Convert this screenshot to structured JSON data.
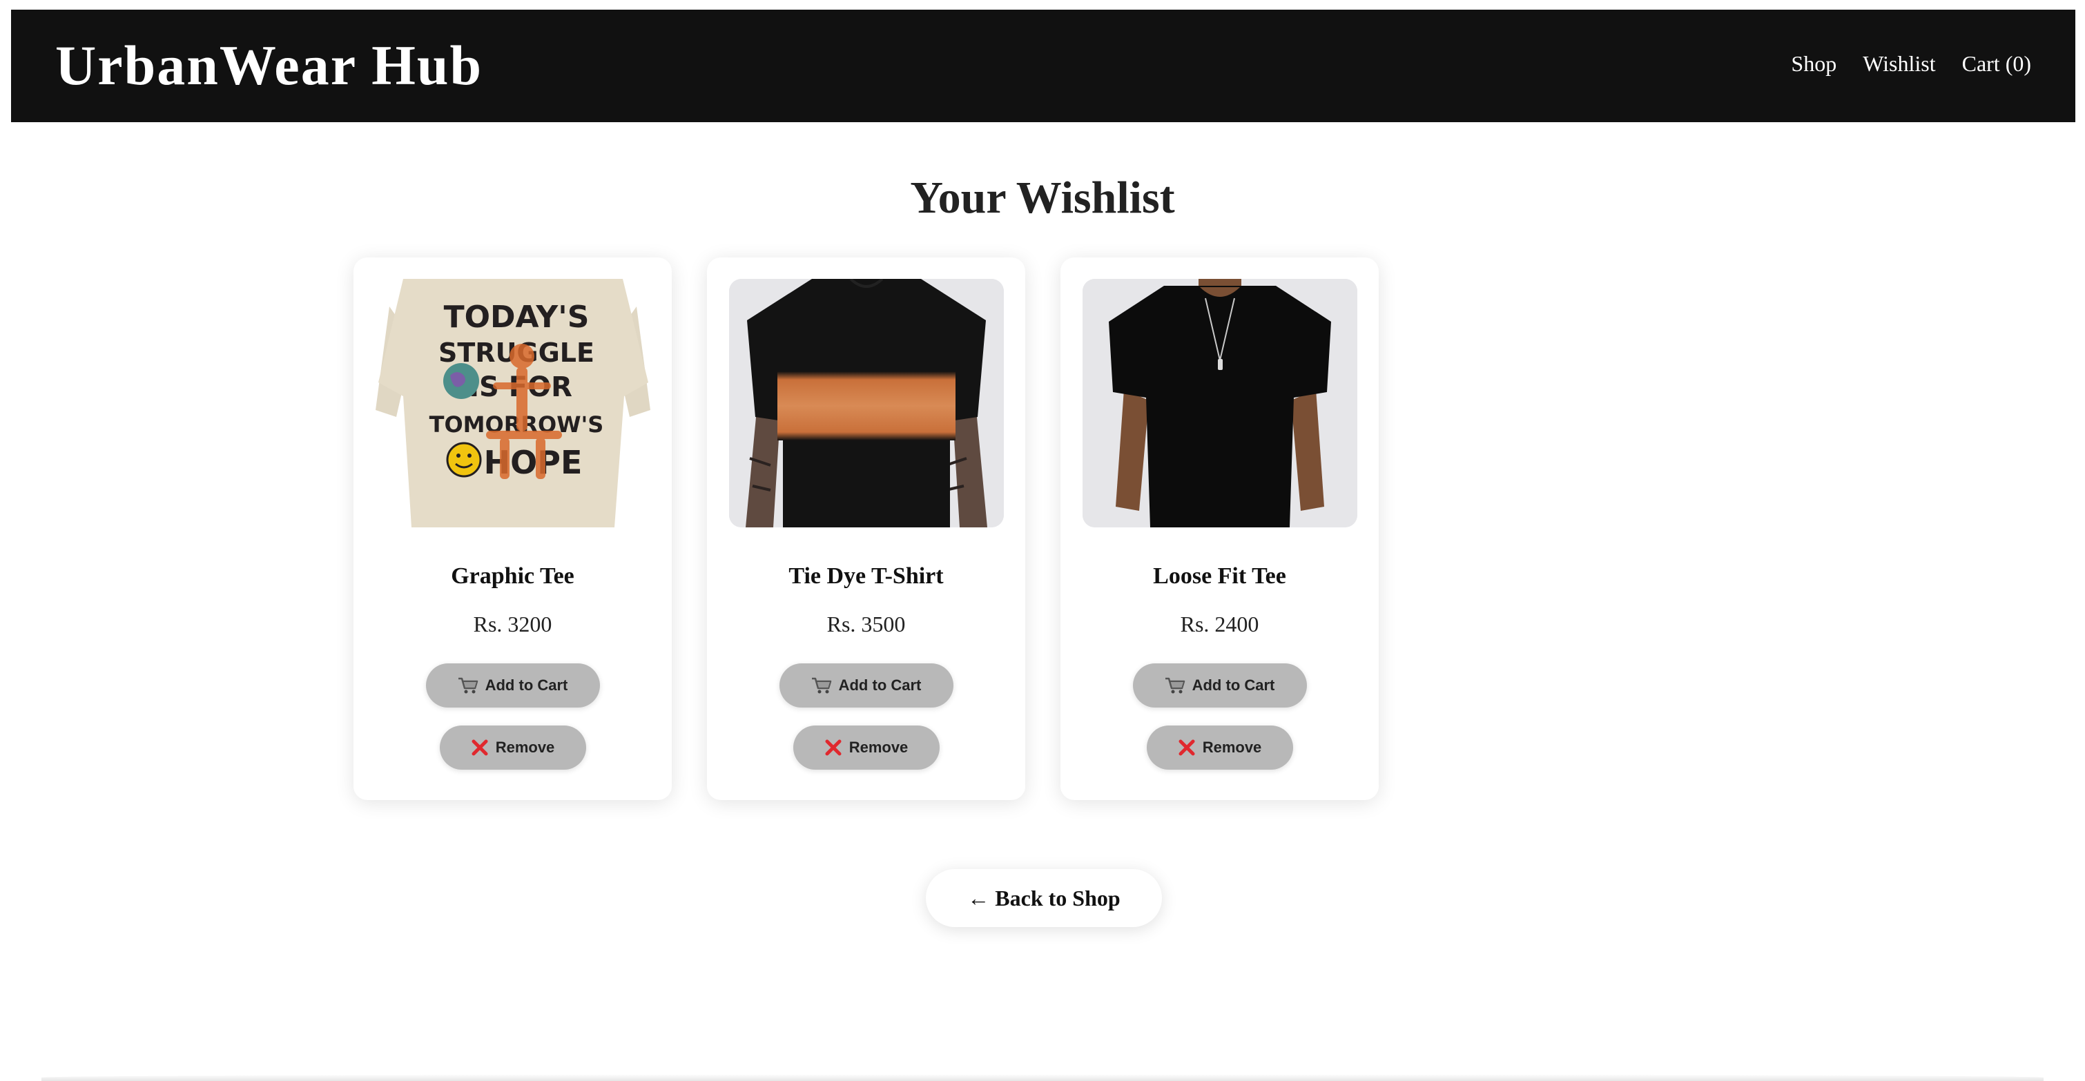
{
  "header": {
    "logo": "UrbanWear Hub",
    "nav": [
      {
        "label": "Shop"
      },
      {
        "label": "Wishlist"
      },
      {
        "label": "Cart (0)"
      }
    ]
  },
  "page": {
    "title": "Your Wishlist"
  },
  "products": [
    {
      "name": "Graphic Tee",
      "price": "Rs. 3200",
      "add_to_cart": "Add to Cart",
      "remove": "Remove",
      "image_print_text": [
        "TODAY'S",
        "STRUGGLE",
        "IS FOR",
        "TOMORROW'S",
        "HOPE"
      ]
    },
    {
      "name": "Tie Dye T-Shirt",
      "price": "Rs. 3500",
      "add_to_cart": "Add to Cart",
      "remove": "Remove"
    },
    {
      "name": "Loose Fit Tee",
      "price": "Rs. 2400",
      "add_to_cart": "Add to Cart",
      "remove": "Remove"
    }
  ],
  "back_button": {
    "arrow": "←",
    "label": "Back to Shop"
  },
  "icons": {
    "cart": "shopping-cart-icon",
    "remove": "cross-mark-icon"
  },
  "colors": {
    "header_bg": "#111111",
    "button_bg": "#b8b8b8",
    "remove_icon": "#e0282e"
  }
}
